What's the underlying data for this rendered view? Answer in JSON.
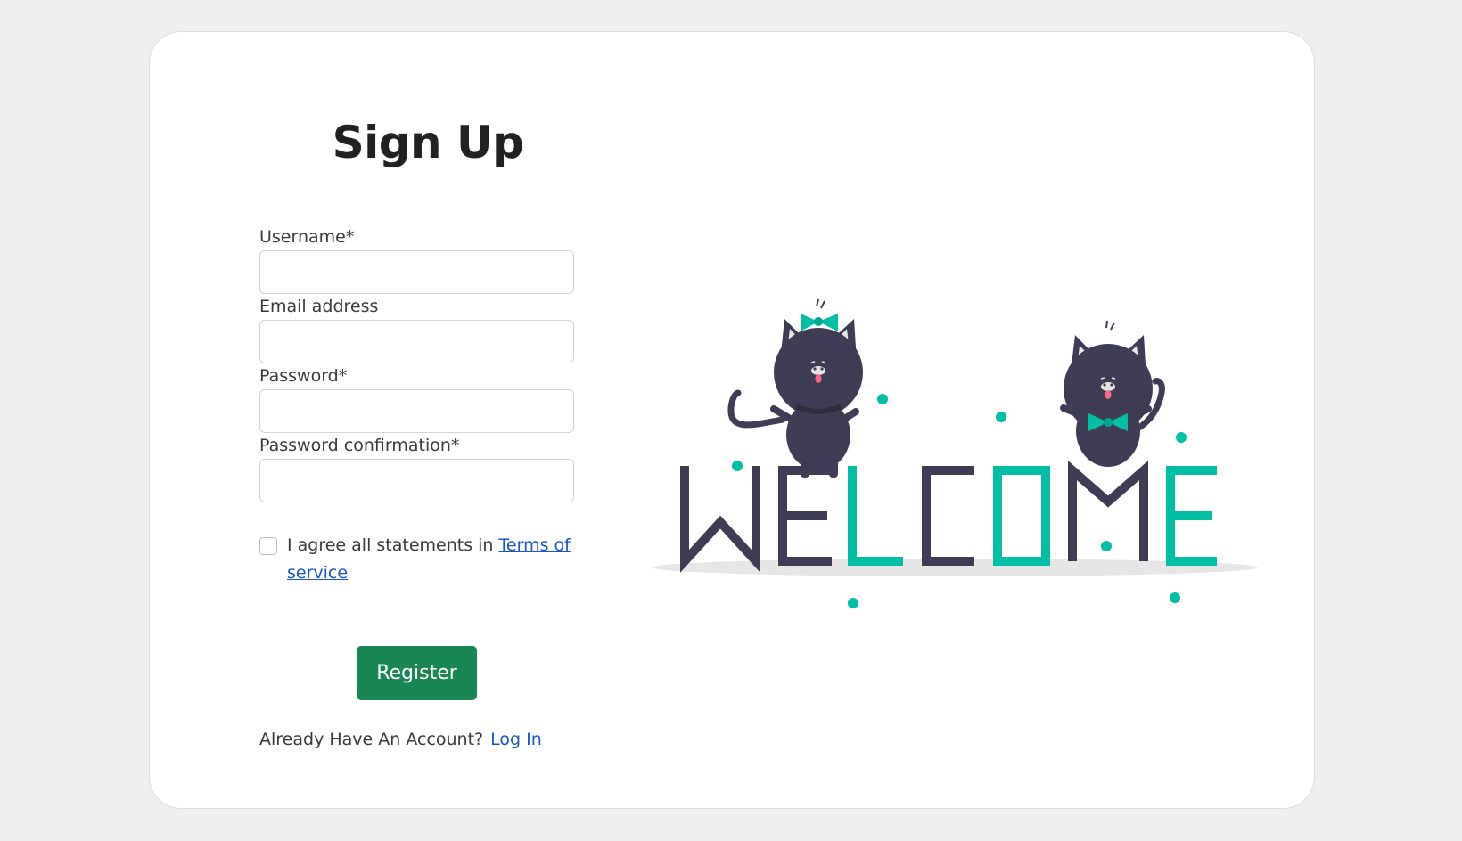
{
  "form": {
    "title": "Sign Up",
    "fields": [
      {
        "label": "Username*",
        "value": "",
        "placeholder": ""
      },
      {
        "label": "Email address",
        "value": "",
        "placeholder": ""
      },
      {
        "label": "Password*",
        "value": "",
        "placeholder": ""
      },
      {
        "label": "Password confirmation*",
        "value": "",
        "placeholder": ""
      }
    ],
    "agree_text": "I agree all statements in ",
    "terms_link": "Terms of service",
    "agree_checked": false,
    "register_label": "Register",
    "account_prompt": "Already Have An Account?",
    "login_link": "Log In"
  },
  "illustration": {
    "word": [
      "W",
      "E",
      "L",
      "C",
      "O",
      "M",
      "E"
    ],
    "dark_color": "#3f3d56",
    "accent_color": "#00bfa6",
    "shadow_color": "#e6e6e6"
  },
  "colors": {
    "page_background": "#eeeeee",
    "card_background": "#ffffff",
    "primary_button": "#198754",
    "link": "#1a55c9"
  }
}
